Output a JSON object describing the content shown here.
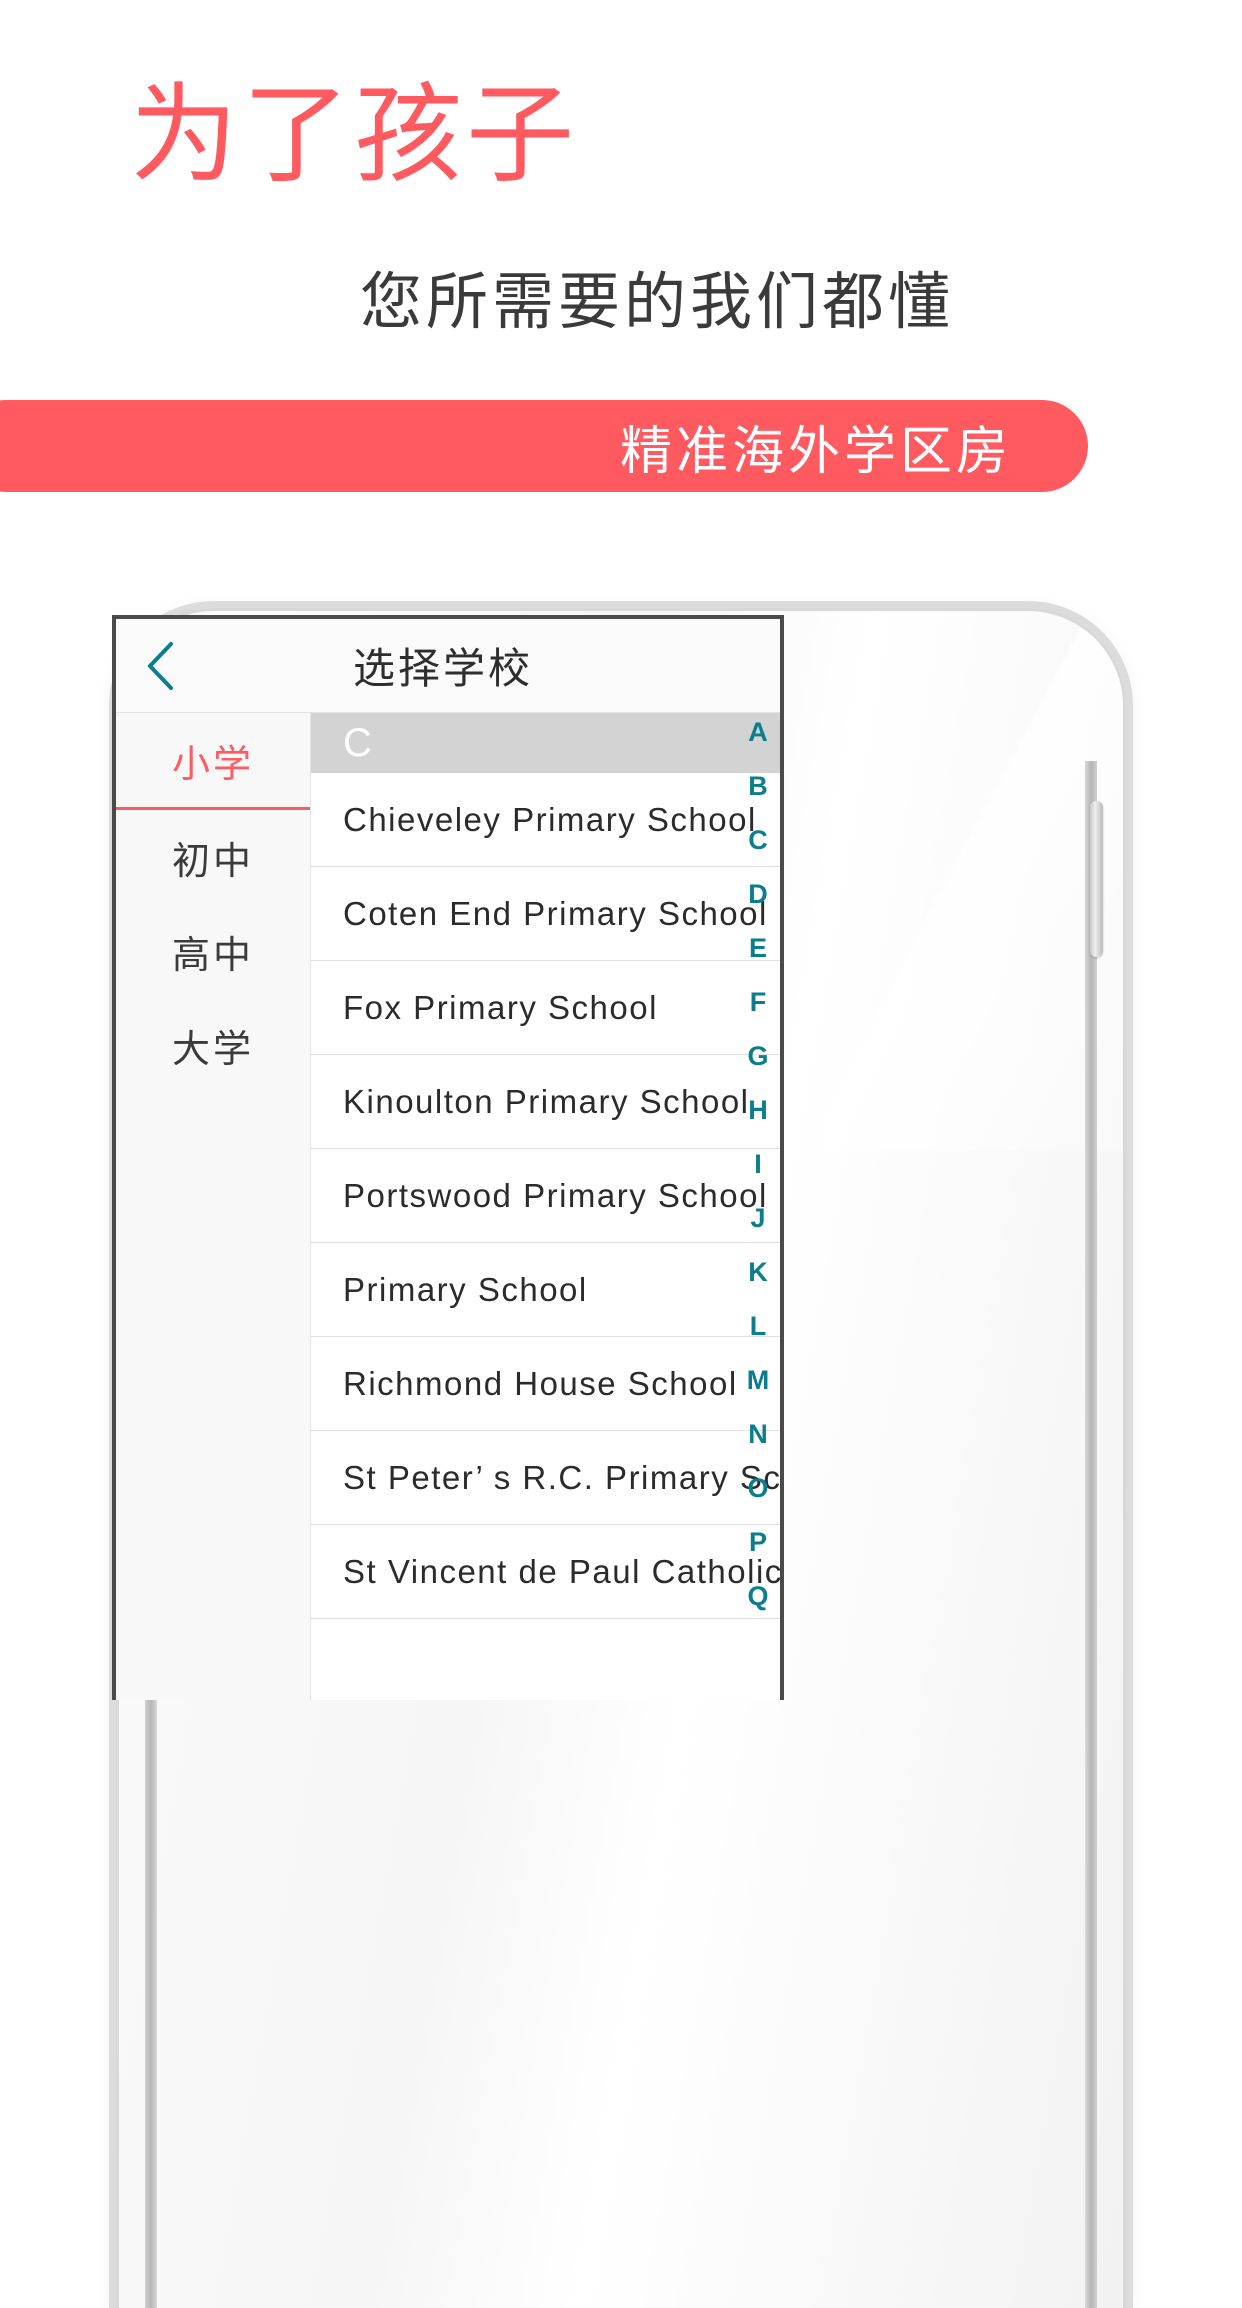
{
  "promo": {
    "title": "为了孩子",
    "subtitle": "您所需要的我们都懂",
    "banner_text": "精准海外学区房",
    "accent_color": "#ff5a5f",
    "text_color": "#3a3a3a",
    "banner_text_color": "#ffffff"
  },
  "app": {
    "nav": {
      "back_icon": "chevron-left-icon",
      "title": "选择学校",
      "back_color": "#0a7e8c"
    },
    "sidebar": {
      "items": [
        {
          "label": "小学",
          "active": true
        },
        {
          "label": "初中",
          "active": false
        },
        {
          "label": "高中",
          "active": false
        },
        {
          "label": "大学",
          "active": false
        }
      ]
    },
    "list": {
      "section_header": "C",
      "rows": [
        {
          "name": "Chieveley Primary School"
        },
        {
          "name": "Coten End Primary School"
        },
        {
          "name": "Fox Primary School"
        },
        {
          "name": "Kinoulton Primary School"
        },
        {
          "name": "Portswood Primary School"
        },
        {
          "name": "Primary School"
        },
        {
          "name": "Richmond House School"
        },
        {
          "name": "St Peter’ s R.C. Primary School"
        },
        {
          "name": "St Vincent de Paul Catholic"
        }
      ]
    },
    "index_bar": {
      "letters": [
        "A",
        "B",
        "C",
        "D",
        "E",
        "F",
        "G",
        "H",
        "I",
        "J",
        "K",
        "L",
        "M",
        "N",
        "O",
        "P",
        "Q"
      ],
      "color": "#0a7e8c"
    }
  },
  "device": {
    "camera_icon": "front-camera-icon",
    "speaker_icon": "earpiece-speaker-icon",
    "sensor_icon": "proximity-sensor-icon",
    "buttons": [
      "mute-switch",
      "volume-up-button",
      "volume-down-button",
      "power-button"
    ]
  }
}
